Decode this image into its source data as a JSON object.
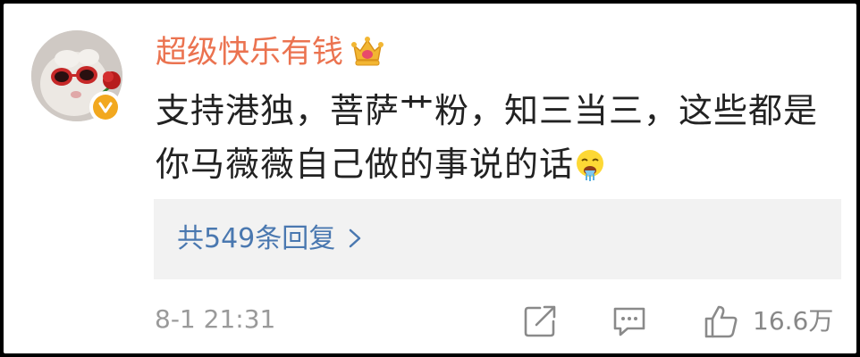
{
  "comment": {
    "author": "超级快乐有钱",
    "author_badge_icon": "crown-icon",
    "text": "支持港独，菩萨艹粉，知三当三，这些都是你马薇薇自己做的事说的话",
    "emoji_icon": "vomit-emoji-icon",
    "replies_label": "共549条回复",
    "timestamp": "8-1 21:31",
    "like_count": "16.6万",
    "colors": {
      "author": "#eb7350",
      "link": "#4a78b0",
      "meta": "#9a9a9a",
      "verified": "#f2a81f"
    }
  }
}
